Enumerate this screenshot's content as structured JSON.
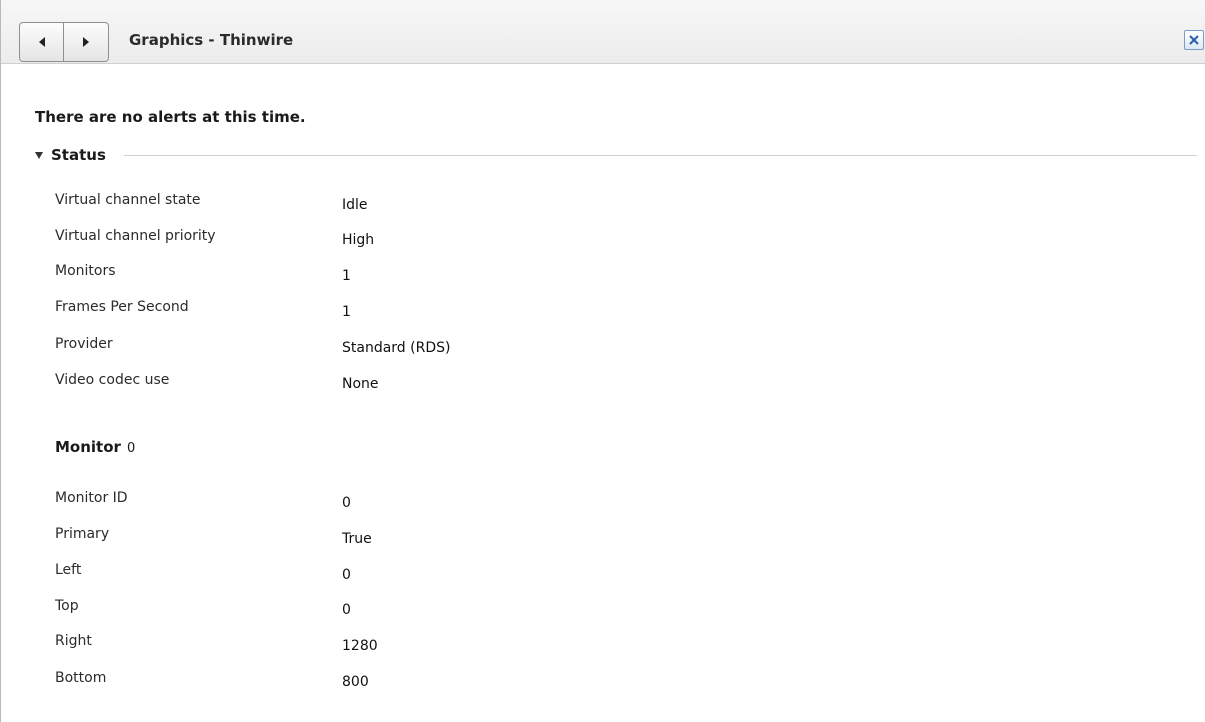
{
  "header": {
    "title": "Graphics - Thinwire",
    "back_icon": "triangle-left-icon",
    "forward_icon": "triangle-right-icon",
    "close_icon": "close-icon"
  },
  "alerts": {
    "message": "There are no alerts at this time."
  },
  "status": {
    "label": "Status",
    "rows": [
      {
        "label": "Virtual channel state",
        "value": "Idle"
      },
      {
        "label": "Virtual channel priority",
        "value": "High"
      },
      {
        "label": "Monitors",
        "value": "1"
      },
      {
        "label": "Frames Per Second",
        "value": "1"
      },
      {
        "label": "Provider",
        "value": "Standard (RDS)"
      },
      {
        "label": "Video codec use",
        "value": "None"
      }
    ]
  },
  "monitor": {
    "title": "Monitor",
    "index": "0",
    "rows": [
      {
        "label": "Monitor ID",
        "value": "0"
      },
      {
        "label": "Primary",
        "value": "True"
      },
      {
        "label": "Left",
        "value": "0"
      },
      {
        "label": "Top",
        "value": "0"
      },
      {
        "label": "Right",
        "value": "1280"
      },
      {
        "label": "Bottom",
        "value": "800"
      }
    ]
  },
  "colors": {
    "close_accent": "#2a5fa8",
    "nav_border": "#8f8f8f",
    "rule": "#cfcfcf"
  }
}
